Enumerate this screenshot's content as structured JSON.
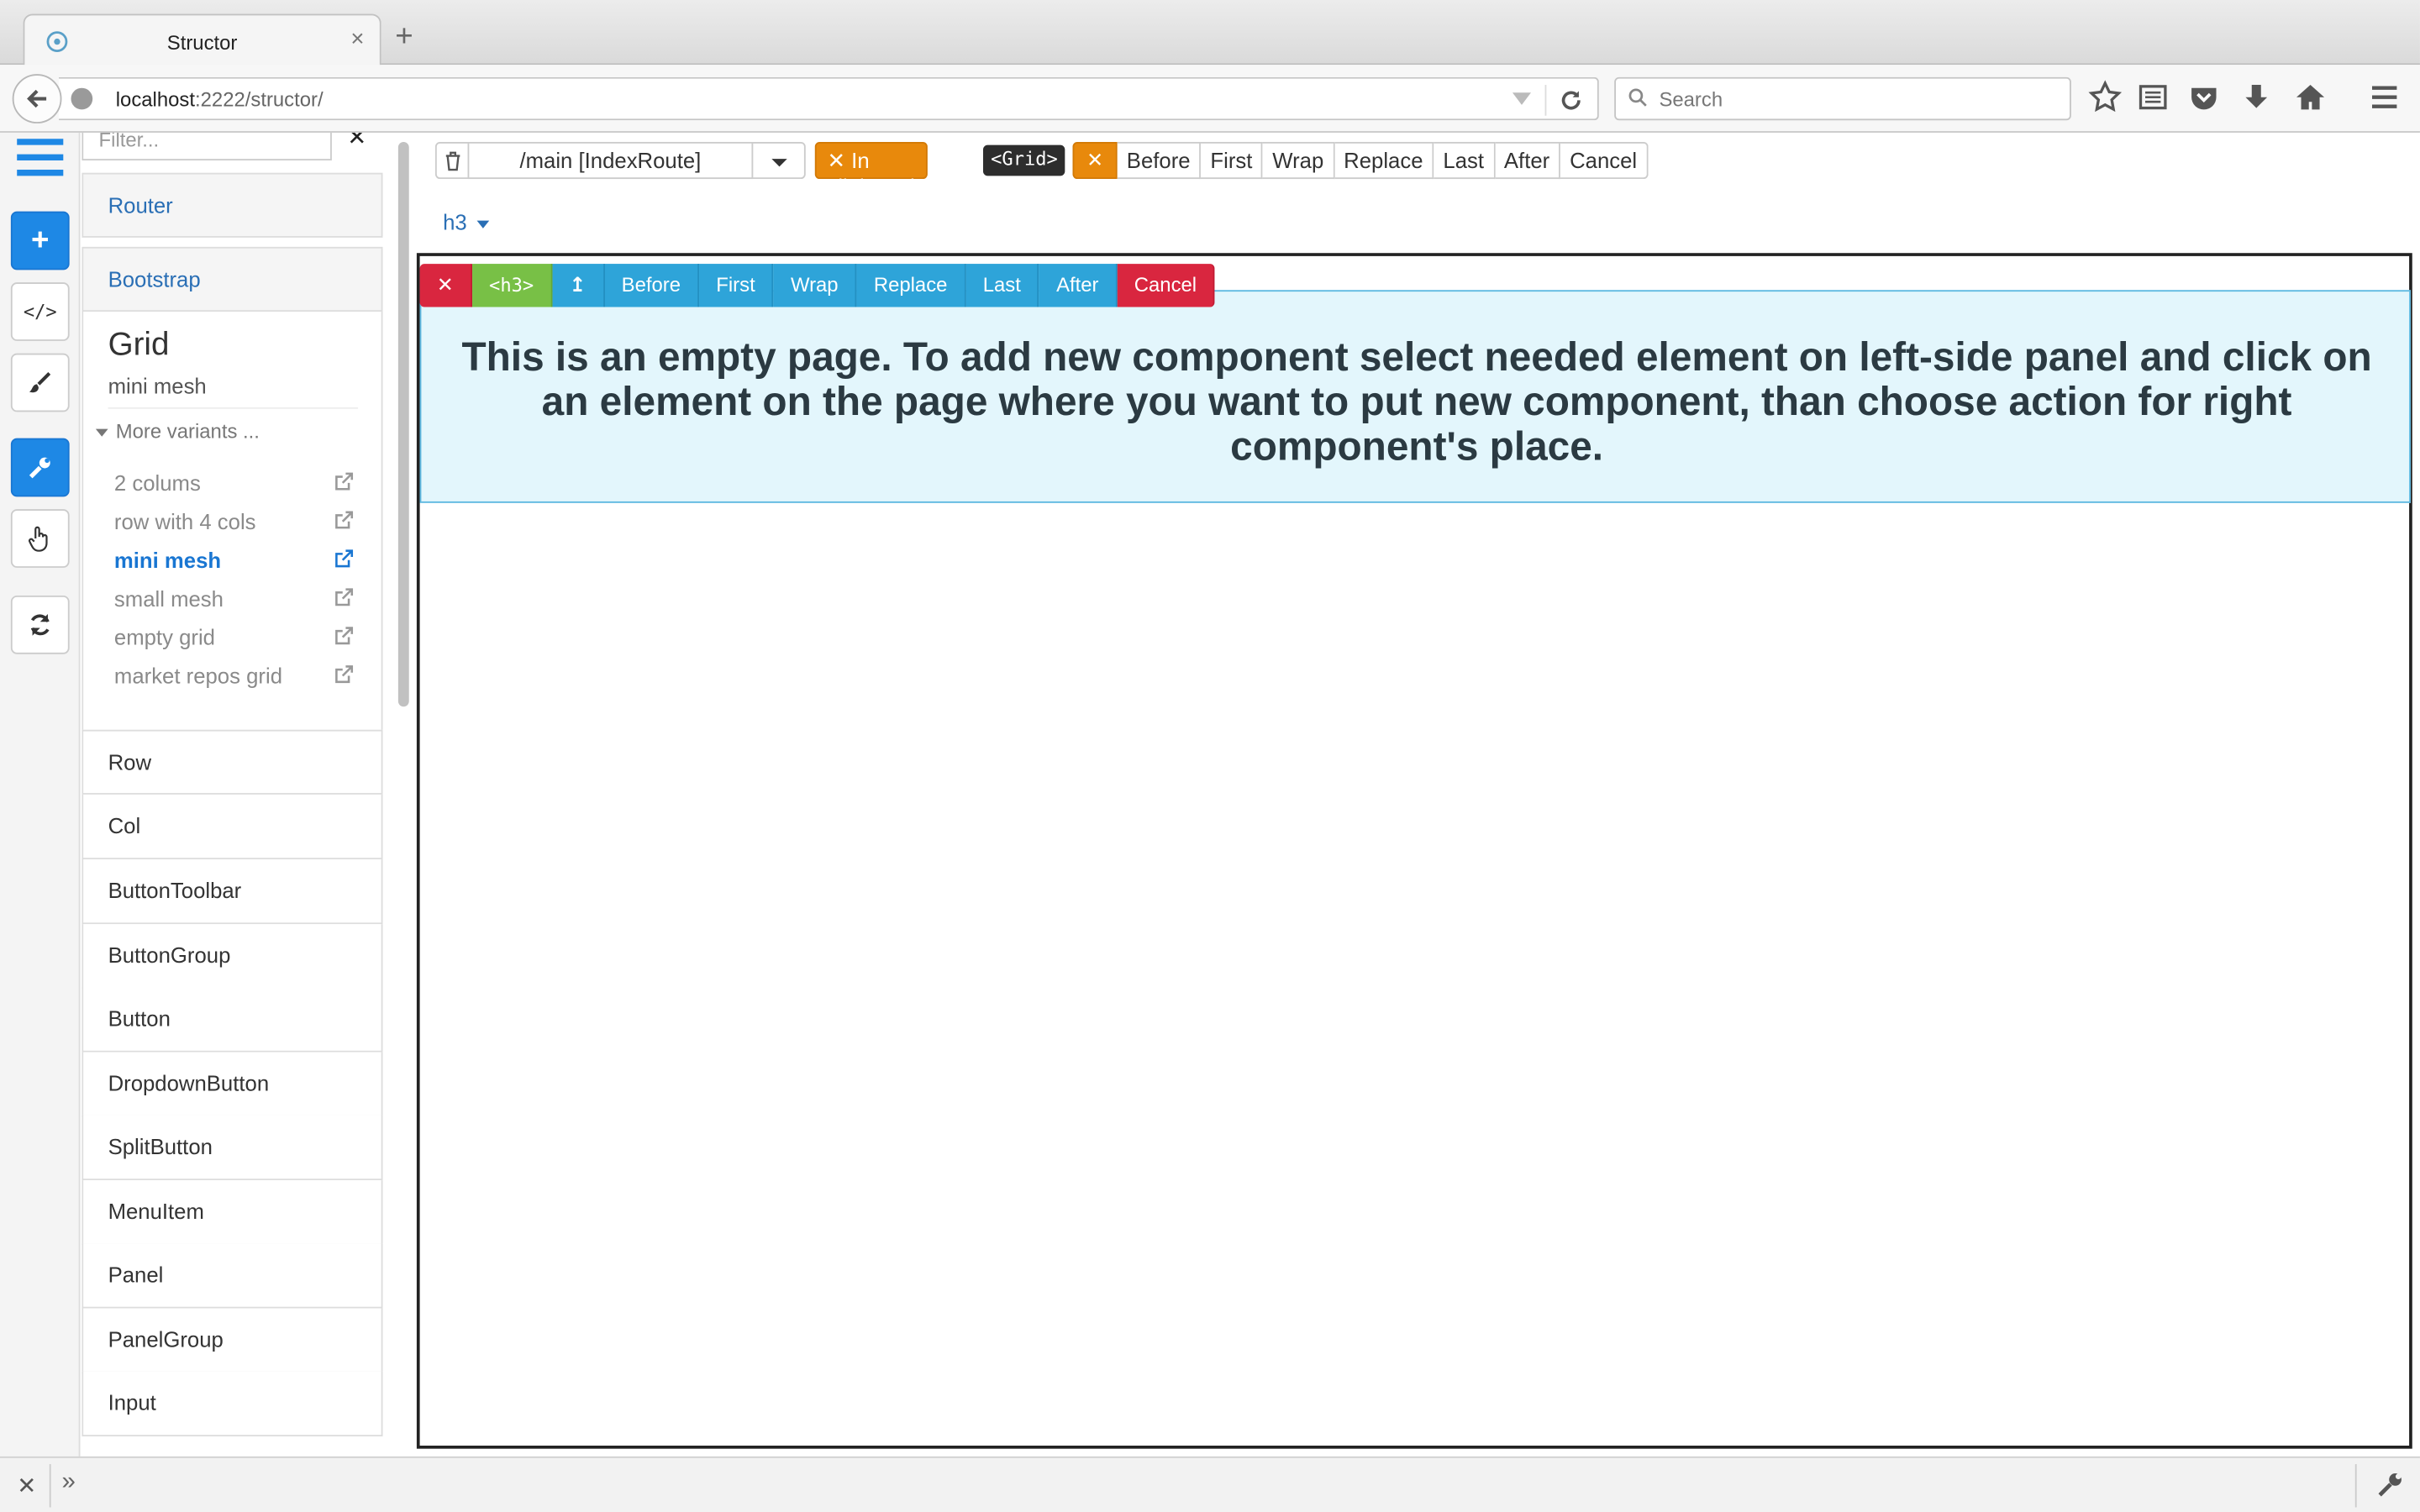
{
  "browser": {
    "tab_title": "Structor",
    "url_host": "localhost",
    "url_path": ":2222/structor/",
    "search_placeholder": "Search"
  },
  "palette": {
    "filter_placeholder": "Filter...",
    "groups": [
      "Router",
      "Bootstrap"
    ],
    "grid": {
      "title": "Grid",
      "subtitle": "mini mesh",
      "more_variants": "More variants ...",
      "variants": [
        "2 colums",
        "row with 4 cols",
        "mini mesh",
        "small mesh",
        "empty grid",
        "market repos grid"
      ],
      "active_variant": "mini mesh"
    },
    "components": [
      "Row",
      "Col",
      "ButtonToolbar",
      "ButtonGroup",
      "Button",
      "DropdownButton",
      "SplitButton",
      "MenuItem",
      "Panel",
      "PanelGroup",
      "Input"
    ]
  },
  "toolbar": {
    "route": "/main [IndexRoute]",
    "clipboard_label": "In clipboard",
    "clipboard_tag": "<Grid>",
    "actions": [
      "Before",
      "First",
      "Wrap",
      "Replace",
      "Last",
      "After",
      "Cancel"
    ]
  },
  "breadcrumb": {
    "label": "h3"
  },
  "canvas": {
    "selected_tag": "<h3>",
    "overlay_actions": [
      "Before",
      "First",
      "Wrap",
      "Replace",
      "Last",
      "After"
    ],
    "overlay_cancel": "Cancel",
    "heading_text": "This is an empty page. To add new component select needed element on left-side panel and click on an element on the page where you want to put new component, than choose action for right component's place."
  },
  "colors": {
    "primary": "#1e88e5",
    "clipboard": "#e8890c",
    "selection_bg": "#e3f6fc",
    "overlay_button": "#2ea4d9",
    "cancel": "#d9263f",
    "tag": "#78c046"
  },
  "icons": {
    "left_toolbar": [
      "menu-icon",
      "plus-icon",
      "code-icon",
      "brush-icon",
      "wrench-icon",
      "hand-pointer-icon",
      "refresh-icon"
    ]
  }
}
